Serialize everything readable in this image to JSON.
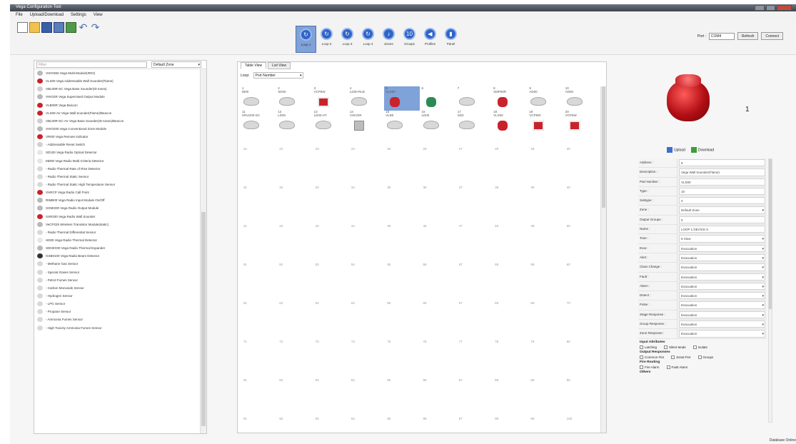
{
  "app": {
    "title": "Vega Configuration Tool"
  },
  "menu": [
    "File",
    "Upload/Download",
    "Settings",
    "View"
  ],
  "toolbar": {
    "quick_icons": [
      "new-file-icon",
      "open-folder-icon",
      "save-icon",
      "save-as-icon",
      "export-icon",
      "undo-icon",
      "redo-icon"
    ],
    "loops": [
      {
        "label": "Loop 1",
        "icon": "loop-icon",
        "active": true
      },
      {
        "label": "Loop 2",
        "icon": "loop-icon"
      },
      {
        "label": "Loop 3",
        "icon": "loop-icon"
      },
      {
        "label": "Loop 4",
        "icon": "loop-icon"
      },
      {
        "label": "Zones",
        "icon": "bell-icon"
      },
      {
        "label": "Groups",
        "icon": "groups-icon"
      },
      {
        "label": "Profiles",
        "icon": "speaker-icon"
      },
      {
        "label": "Panel",
        "icon": "panel-icon"
      }
    ],
    "port_label": "Port :",
    "port_value": "COM4",
    "refresh": "Refresh",
    "connect": "Connect"
  },
  "left": {
    "search_placeholder": "Filter",
    "zone": "Default Zone",
    "devices": [
      {
        "name": "VHIO360 Vega Multi-Module(IRIO)",
        "color": "#b8b8b8"
      },
      {
        "name": "VLS00 Vega Addressable Wall Sounder(Flame)",
        "color": "#c8232b"
      },
      {
        "name": "VBL00R-SC Vega Base Sounder(ID tones)",
        "color": "#cfcfcf"
      },
      {
        "name": "VHIO2R Vega Supervised Output Module",
        "color": "#b8b8b8"
      },
      {
        "name": "VLB00R Vega Beacon",
        "color": "#c8232b"
      },
      {
        "name": "VLS00-AV Vega Wall Sounder(Flame)/Beacon",
        "color": "#c8232b"
      },
      {
        "name": "VBL00R-SC-AV Vega Base Sounder(ID tones)/Beacon",
        "color": "#cfcfcf"
      },
      {
        "name": "VHIO200 Vega Conventional Zone Module",
        "color": "#b8b8b8"
      },
      {
        "name": "VRI00 Vega Remote Indicator",
        "color": "#c8232b"
      },
      {
        "name": "- Addressable Reset Switch",
        "color": "#d0d0d0"
      },
      {
        "name": "SD100 Vega Radio Optical Detector",
        "color": "#e6e6e6"
      },
      {
        "name": "MD00 Vega Radio Multi-Criteria Detector",
        "color": "#e6e6e6"
      },
      {
        "name": "- Radio Thermal Rate of Rise Detector",
        "color": "#d8d8d8"
      },
      {
        "name": "- Radio Thermal Static Sensor",
        "color": "#d8d8d8"
      },
      {
        "name": "- Radio Thermal Static High Temperature Sensor",
        "color": "#d8d8d8"
      },
      {
        "name": "VHRCP Vega Radio Call Point",
        "color": "#c8232b"
      },
      {
        "name": "RIMB00 Vega Radio Input Module On/Off",
        "color": "#b8b8b8"
      },
      {
        "name": "SOMI200 Vega Radio Output Module",
        "color": "#b8b8b8"
      },
      {
        "name": "SSR200 Vega Radio Wall Sounder",
        "color": "#c8232b"
      },
      {
        "name": "VeCP225 Wireless Transistor Module(static)",
        "color": "#b8b8b8"
      },
      {
        "name": "- Radio Thermal Differential Sensor",
        "color": "#d8d8d8"
      },
      {
        "name": "HD00 Vega Radio Thermal Detector",
        "color": "#e6e6e6"
      },
      {
        "name": "SDHEX00 Vega Radio Thermal Expander",
        "color": "#b8b8b8"
      },
      {
        "name": "GSB0100 Vega Radio Beam Detector",
        "color": "#333333"
      },
      {
        "name": "- Methane Gas Sensor",
        "color": "#d8d8d8"
      },
      {
        "name": "- Special Gases Sensor",
        "color": "#d8d8d8"
      },
      {
        "name": "- Petrol Fumes Sensor",
        "color": "#d8d8d8"
      },
      {
        "name": "- Carbon Monoxide Sensor",
        "color": "#d8d8d8"
      },
      {
        "name": "- Hydrogen Sensor",
        "color": "#d8d8d8"
      },
      {
        "name": "- LPG Sensor",
        "color": "#d8d8d8"
      },
      {
        "name": "- Propane Sensor",
        "color": "#d8d8d8"
      },
      {
        "name": "- Ammonia Fumes Sensor",
        "color": "#d8d8d8"
      },
      {
        "name": "- High Toxicity Ammonia Fumes Sensor",
        "color": "#d8d8d8"
      }
    ]
  },
  "middle": {
    "tabs": [
      "Table View",
      "List View"
    ],
    "loop_label": "Loop:",
    "loop_value": "Port Number",
    "row1": [
      {
        "n": "1",
        "name": "IB00",
        "dev": "det"
      },
      {
        "n": "2",
        "name": "SD00",
        "dev": "det"
      },
      {
        "n": "3",
        "name": "VCP6W",
        "dev": "box"
      },
      {
        "n": "4",
        "name": "LD00-RLB",
        "dev": "det"
      },
      {
        "n": "5",
        "name": "VLS00",
        "dev": "red",
        "sel": true
      },
      {
        "n": "6",
        "name": "",
        "dev": "grn"
      },
      {
        "n": "7",
        "name": "",
        "dev": "det"
      },
      {
        "n": "8",
        "name": "SMP00R",
        "dev": "red"
      },
      {
        "n": "9",
        "name": "AD00",
        "dev": "det"
      },
      {
        "n": "10",
        "name": "AD00",
        "dev": "det"
      }
    ],
    "row2": [
      {
        "n": "11",
        "name": "HRLD00-SC",
        "dev": "det"
      },
      {
        "n": "12",
        "name": "LD00",
        "dev": "det"
      },
      {
        "n": "13",
        "name": "LD00-HT",
        "dev": "det"
      },
      {
        "n": "14",
        "name": "VHIO2R",
        "dev": "mod"
      },
      {
        "n": "15",
        "name": "VLB0",
        "dev": "det"
      },
      {
        "n": "16",
        "name": "LD00",
        "dev": "det"
      },
      {
        "n": "17",
        "name": "SD0",
        "dev": "det"
      },
      {
        "n": "18",
        "name": "VLS00",
        "dev": "red"
      },
      {
        "n": "19",
        "name": "VCP6W",
        "dev": "box"
      },
      {
        "n": "20",
        "name": "VCP6W",
        "dev": "box"
      }
    ],
    "empty_rows": [
      [
        "21",
        "22",
        "23",
        "24",
        "25",
        "26",
        "27",
        "28",
        "29",
        "30"
      ],
      [
        "31",
        "32",
        "33",
        "34",
        "35",
        "36",
        "37",
        "38",
        "39",
        "40"
      ],
      [
        "41",
        "42",
        "43",
        "44",
        "45",
        "46",
        "47",
        "48",
        "49",
        "50"
      ],
      [
        "51",
        "52",
        "53",
        "54",
        "55",
        "56",
        "57",
        "58",
        "59",
        "60"
      ],
      [
        "61",
        "62",
        "63",
        "64",
        "65",
        "66",
        "67",
        "68",
        "69",
        "70"
      ],
      [
        "71",
        "72",
        "73",
        "74",
        "75",
        "76",
        "77",
        "78",
        "79",
        "80"
      ],
      [
        "81",
        "82",
        "83",
        "84",
        "85",
        "86",
        "87",
        "88",
        "89",
        "90"
      ],
      [
        "91",
        "92",
        "93",
        "94",
        "95",
        "96",
        "97",
        "98",
        "99",
        "100"
      ]
    ]
  },
  "right": {
    "device_count": "1",
    "upload": "Upload",
    "download": "Download",
    "properties": [
      {
        "k": "Address :",
        "v": "5"
      },
      {
        "k": "Description :",
        "v": "Vega Wall Sounder(Flame)"
      },
      {
        "k": "Part Number :",
        "v": "VLS00"
      },
      {
        "k": "Type :",
        "v": "10"
      },
      {
        "k": "Subtype :",
        "v": "0"
      },
      {
        "k": "Zone :",
        "v": "Default Zone",
        "dd": true
      },
      {
        "k": "Output Groups :",
        "v": "5"
      },
      {
        "k": "Name :",
        "v": "LOOP 1 DEVICE 5"
      },
      {
        "k": "Tone :",
        "v": "8 Slow",
        "dd": true
      },
      {
        "k": "Evac :",
        "v": "Evacuation",
        "dd": true
      },
      {
        "k": "Alert :",
        "v": "Evacuation",
        "dd": true
      },
      {
        "k": "Class Change :",
        "v": "Evacuation",
        "dd": true
      },
      {
        "k": "Fault :",
        "v": "Evacuation",
        "dd": true
      },
      {
        "k": "Alarm :",
        "v": "Evacuation",
        "dd": true
      },
      {
        "k": "Detect :",
        "v": "Evacuation",
        "dd": true
      },
      {
        "k": "Pulse :",
        "v": "Evacuation",
        "dd": true
      },
      {
        "k": "Stage Response :",
        "v": "Evacuation",
        "dd": true
      },
      {
        "k": "Group Response :",
        "v": "Evacuation",
        "dd": true
      },
      {
        "k": "Zone Response :",
        "v": "Evacuation",
        "dd": true
      }
    ],
    "input_attr_title": "Input Attributes",
    "input_attr": [
      "Latching",
      "Silent Mode",
      "Isolate"
    ],
    "output_resp_title": "Output Responses",
    "output_resp": [
      "Common Fire",
      "Zonal Fire",
      "Groups"
    ],
    "fire_title": "Fire Routing",
    "fire": [
      "Fire Alarm",
      "Fault Alarm"
    ],
    "others_title": "Others"
  },
  "status": "Database Online"
}
